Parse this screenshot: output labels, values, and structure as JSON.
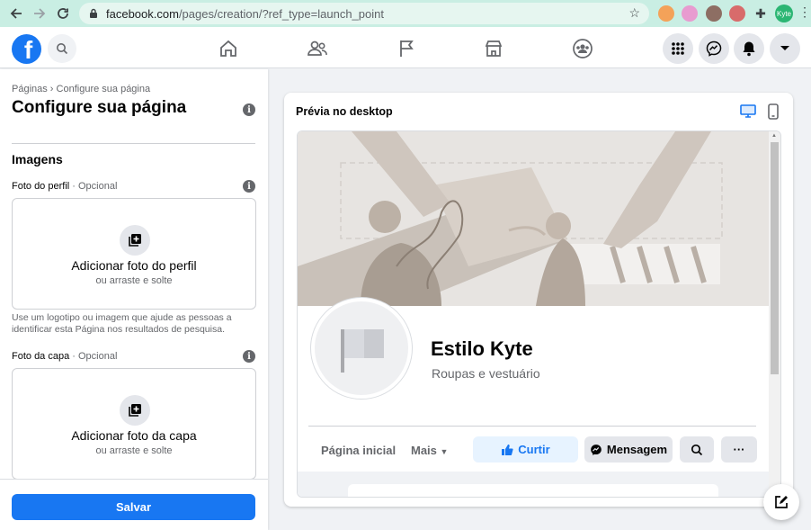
{
  "browser": {
    "url_host": "facebook.com",
    "url_path": "/pages/creation/?ref_type=launch_point",
    "profile_label": "Kyte"
  },
  "fb": {
    "logo_letter": "f"
  },
  "left": {
    "breadcrumb": "Páginas › Configure sua página",
    "title": "Configure sua página",
    "section": "Imagens",
    "profile_label": "Foto do perfil",
    "profile_optional": " · Opcional",
    "profile_upload": "Adicionar foto do perfil",
    "profile_sub": "ou arraste e solte",
    "hint": "Use um logotipo ou imagem que ajude as pessoas a identificar esta Página nos resultados de pesquisa.",
    "cover_label": "Foto da capa",
    "cover_optional": " · Opcional",
    "cover_upload": "Adicionar foto da capa",
    "cover_sub": "ou arraste e solte",
    "save": "Salvar"
  },
  "preview": {
    "title": "Prévia no desktop",
    "page_name": "Estilo Kyte",
    "page_category": "Roupas e vestuário",
    "tab_home": "Página inicial",
    "tab_more": "Mais",
    "like": "Curtir",
    "message": "Mensagem",
    "more_dots": "···"
  },
  "colors": {
    "brand": "#1877f2",
    "chrome": "#c9eee3",
    "like_bg": "#e7f3ff"
  }
}
